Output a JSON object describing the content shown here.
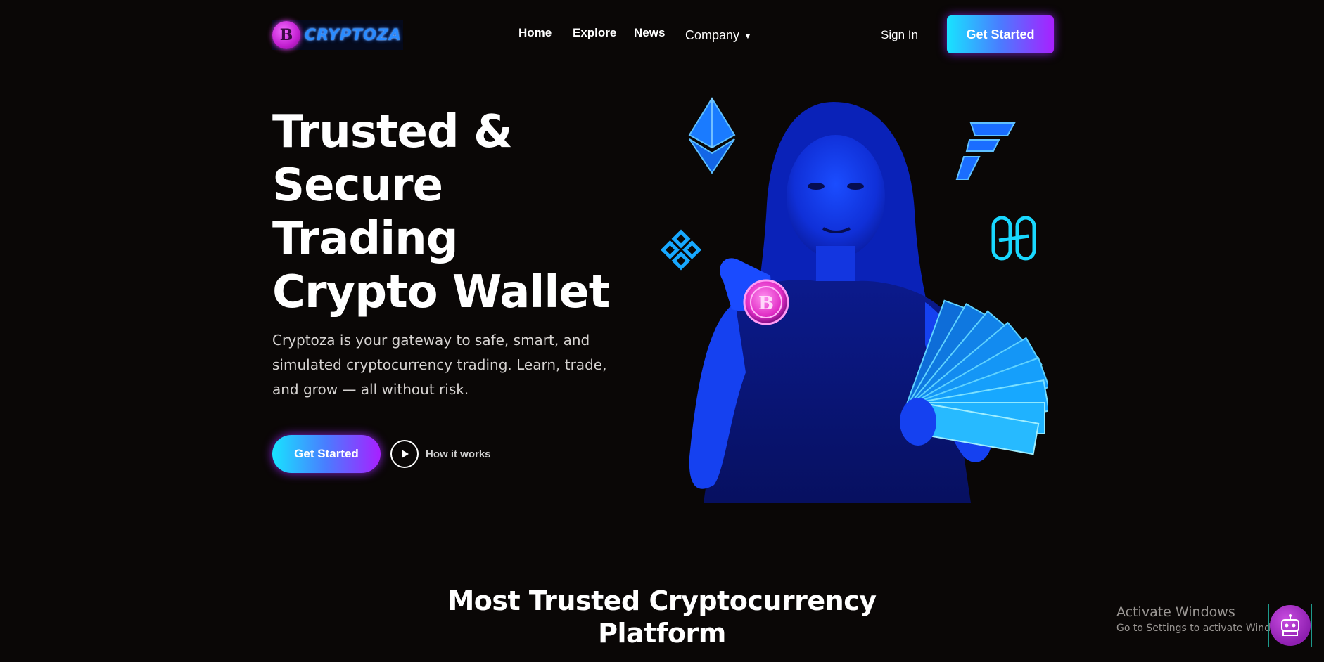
{
  "brand": {
    "name": "CRYPTOZA",
    "logo_letter": "B"
  },
  "nav": {
    "links": [
      "Home",
      "Explore",
      "News"
    ],
    "company": "Company",
    "sign_in": "Sign In",
    "cta": "Get Started"
  },
  "hero": {
    "title_lines": [
      "Trusted &",
      "Secure",
      "Trading",
      "Crypto Wallet"
    ],
    "description": "Cryptoza is your gateway to safe, smart, and simulated cryptocurrency trading. Learn, trade, and grow — all without risk.",
    "cta": "Get Started",
    "secondary": "How it works"
  },
  "section": {
    "title_lines": [
      "Most Trusted Cryptocurrency",
      "Platform"
    ]
  },
  "windows_watermark": {
    "line1": "Activate Windows",
    "line2": "Go to Settings to activate Windows."
  },
  "colors": {
    "background": "#0a0706",
    "gradient_start": "#18e3ff",
    "gradient_end": "#a820ff",
    "neon_blue": "#1f6bff",
    "neon_pink": "#e13cf3"
  },
  "icons": {
    "logo": "bitcoin-coin-icon",
    "play": "play-icon",
    "chatbot": "robot-icon",
    "floating": [
      "ethereum-icon",
      "binance-icon",
      "ftx-icon",
      "harmony-icon"
    ]
  }
}
